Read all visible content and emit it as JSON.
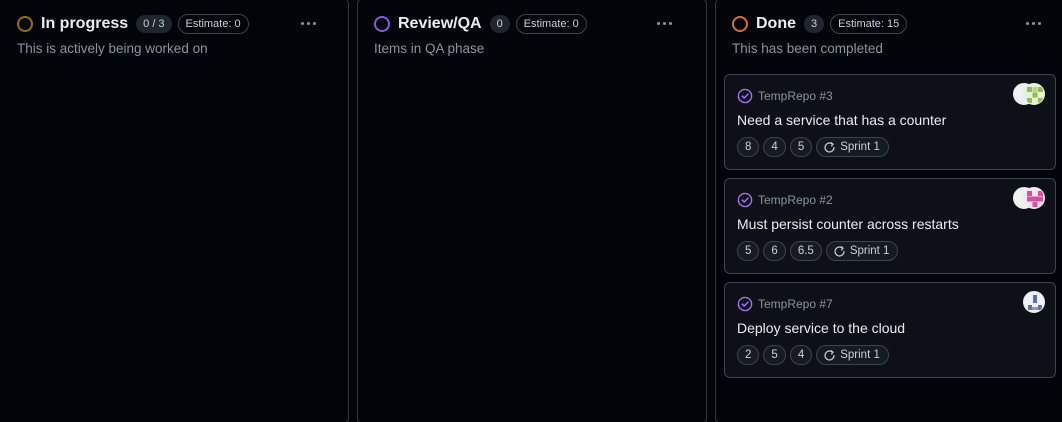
{
  "columns": [
    {
      "title": "In progress",
      "count": "0 / 3",
      "estimate": "Estimate: 0",
      "description": "This is actively being worked on",
      "status_color": "#9e6a03"
    },
    {
      "title": "Review/QA",
      "count": "0",
      "estimate": "Estimate: 0",
      "description": "Items in QA phase",
      "status_color": "#8957e5"
    },
    {
      "title": "Done",
      "count": "3",
      "estimate": "Estimate: 15",
      "description": "This has been completed",
      "status_color": "#db6d28",
      "cards": [
        {
          "ref": "TempRepo #3",
          "title": "Need a service that has a counter",
          "fields": [
            "8",
            "4",
            "5"
          ],
          "iteration": "Sprint 1",
          "avatars": [
            "identicon-white",
            "identicon-green"
          ]
        },
        {
          "ref": "TempRepo #2",
          "title": "Must persist counter across restarts",
          "fields": [
            "5",
            "6",
            "6.5"
          ],
          "iteration": "Sprint 1",
          "avatars": [
            "identicon-white",
            "identicon-pink"
          ]
        },
        {
          "ref": "TempRepo #7",
          "title": "Deploy service to the cloud",
          "fields": [
            "2",
            "5",
            "4"
          ],
          "iteration": "Sprint 1",
          "avatars": [
            "identicon-blue"
          ]
        }
      ]
    }
  ],
  "colors": {
    "background": "#010409",
    "card_background": "#0d1117",
    "border": "#30363d",
    "done_icon": "#a371f7",
    "muted_text": "#8b949e"
  }
}
